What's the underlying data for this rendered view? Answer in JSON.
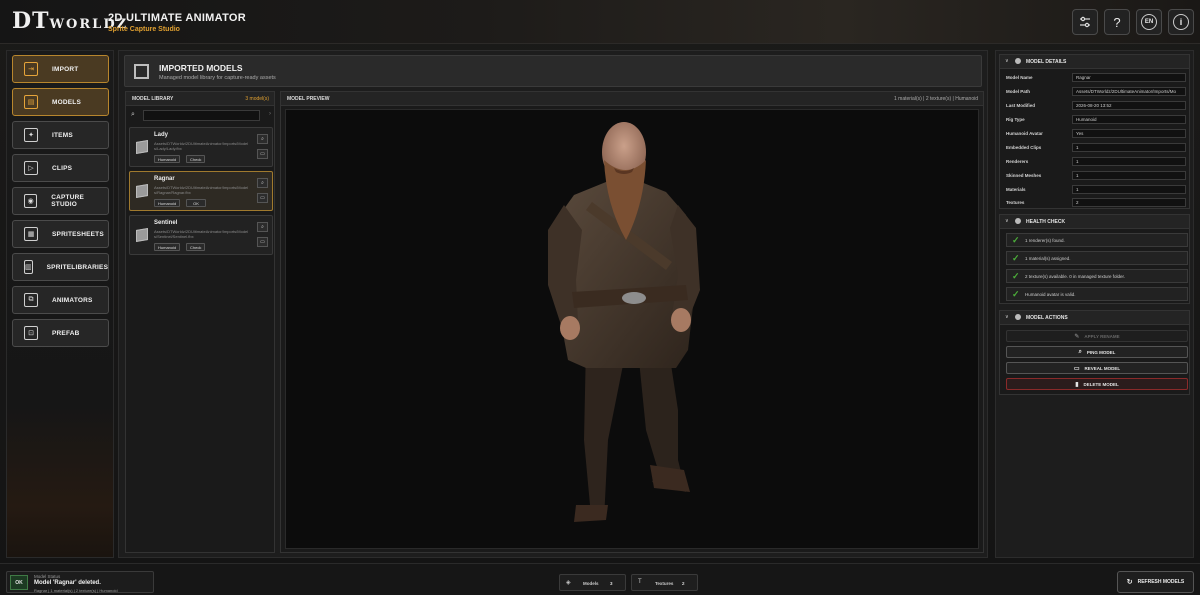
{
  "header": {
    "logo_main": "DT",
    "logo_sub": "WORLDZ",
    "title": "2D ULTIMATE ANIMATOR",
    "subtitle": "Sprite Capture Studio",
    "buttons": {
      "settings_icon": "sliders-icon",
      "help": "?",
      "language": "EN",
      "info": "i"
    }
  },
  "sidebar": {
    "items": [
      {
        "label": "IMPORT",
        "icon": "import-icon",
        "active": true
      },
      {
        "label": "MODELS",
        "icon": "models-icon",
        "active": true
      },
      {
        "label": "ITEMS",
        "icon": "items-icon",
        "active": false
      },
      {
        "label": "CLIPS",
        "icon": "clips-icon",
        "active": false
      },
      {
        "label": "CAPTURE STUDIO",
        "icon": "camera-icon",
        "active": false
      },
      {
        "label": "SPRITESHEETS",
        "icon": "spritesheet-icon",
        "active": false
      },
      {
        "label": "SPRITELIBRARIES",
        "icon": "library-icon",
        "active": false
      },
      {
        "label": "ANIMATORS",
        "icon": "animator-icon",
        "active": false
      },
      {
        "label": "PREFAB",
        "icon": "prefab-icon",
        "active": false
      }
    ]
  },
  "main": {
    "title": "IMPORTED MODELS",
    "subtitle": "Managed model library for capture-ready assets",
    "library": {
      "heading": "MODEL LIBRARY",
      "count": "3 model(s)",
      "search_placeholder": "",
      "models": [
        {
          "name": "Lady",
          "path": "Assets/DTWorldz/2DUltimateAnimator/Imports/Models/Lady/Lady.fbx",
          "rig": "Humanoid",
          "state": "Check",
          "selected": false
        },
        {
          "name": "Ragnar",
          "path": "Assets/DTWorldz/2DUltimateAnimator/Imports/Models/Ragnar/Ragnar.fbx",
          "rig": "Humanoid",
          "state": "OK",
          "selected": true
        },
        {
          "name": "Sentinel",
          "path": "Assets/DTWorldz/2DUltimateAnimator/Imports/Models/Sentinel/Sentinel.fbx",
          "rig": "Humanoid",
          "state": "Check",
          "selected": false
        }
      ]
    },
    "preview": {
      "heading": "MODEL PREVIEW",
      "info": "1 material(s) | 2 texture(s) | Humanoid"
    }
  },
  "details": {
    "heading": "MODEL DETAILS",
    "rows": [
      {
        "key": "Model Name",
        "value": "Ragnar"
      },
      {
        "key": "Model Path",
        "value": "Assets/DTWorldz/2DUltimateAnimator/Imports/Mo"
      },
      {
        "key": "Last Modified",
        "value": "2026-08-20 13:52"
      },
      {
        "key": "Rig Type",
        "value": "Humanoid"
      },
      {
        "key": "Humanoid Avatar",
        "value": "Yes"
      },
      {
        "key": "Embedded Clips",
        "value": "1"
      },
      {
        "key": "Renderers",
        "value": "1"
      },
      {
        "key": "Skinned Meshes",
        "value": "1"
      },
      {
        "key": "Materials",
        "value": "1"
      },
      {
        "key": "Textures",
        "value": "2"
      }
    ]
  },
  "health": {
    "heading": "HEALTH CHECK",
    "items": [
      "1 renderer(s) found.",
      "1 material(s) assigned.",
      "2 texture(s) available. 0 in managed texture folder.",
      "Humanoid avatar is valid."
    ]
  },
  "actions": {
    "heading": "MODEL ACTIONS",
    "apply_rename": "APPLY RENAME",
    "ping": "PING MODEL",
    "reveal": "REVEAL MODEL",
    "delete": "DELETE MODEL"
  },
  "footer": {
    "status_badge": "OK",
    "status_label": "Model Status",
    "status_message": "Model 'Ragnar' deleted.",
    "status_detail": "Ragnar | 1 material(s) | 2 texture(s) | Humanoid",
    "models_label": "Models",
    "models_count": "3",
    "textures_label": "Textures",
    "textures_count": "2",
    "refresh": "REFRESH MODELS"
  },
  "colors": {
    "accent": "#e0a030",
    "active_border": "#b8862d",
    "ok_green": "#4caf3a",
    "danger": "#8a2a2a"
  }
}
